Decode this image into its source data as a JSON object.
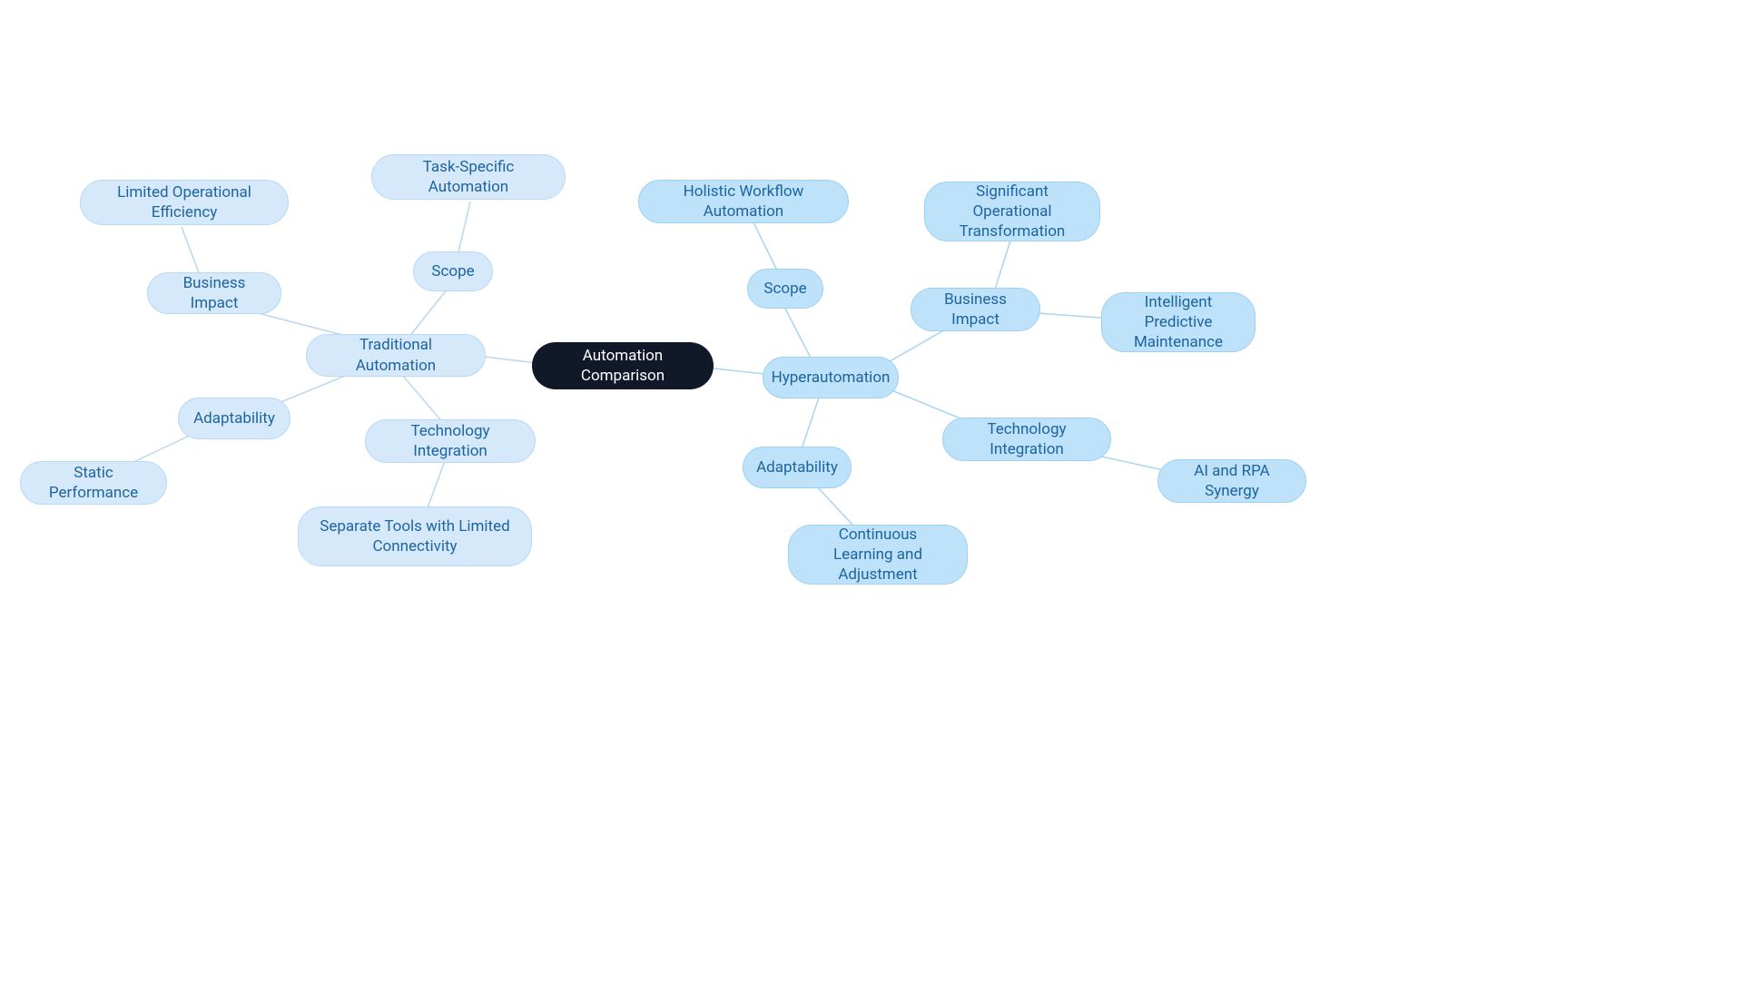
{
  "root": {
    "label": "Automation Comparison"
  },
  "left": {
    "main": "Traditional Automation",
    "scope": {
      "label": "Scope",
      "leaf": "Task-Specific Automation"
    },
    "business": {
      "label": "Business Impact",
      "leaf": "Limited Operational Efficiency"
    },
    "adapt": {
      "label": "Adaptability",
      "leaf": "Static Performance"
    },
    "tech": {
      "label": "Technology Integration",
      "leaf": "Separate Tools with Limited Connectivity"
    }
  },
  "right": {
    "main": "Hyperautomation",
    "scope": {
      "label": "Scope",
      "leaf": "Holistic Workflow Automation"
    },
    "business": {
      "label": "Business Impact",
      "leaf1": "Significant Operational Transformation",
      "leaf2": "Intelligent Predictive Maintenance"
    },
    "adapt": {
      "label": "Adaptability",
      "leaf": "Continuous Learning and Adjustment"
    },
    "tech": {
      "label": "Technology Integration",
      "leaf": "AI and RPA Synergy"
    }
  }
}
